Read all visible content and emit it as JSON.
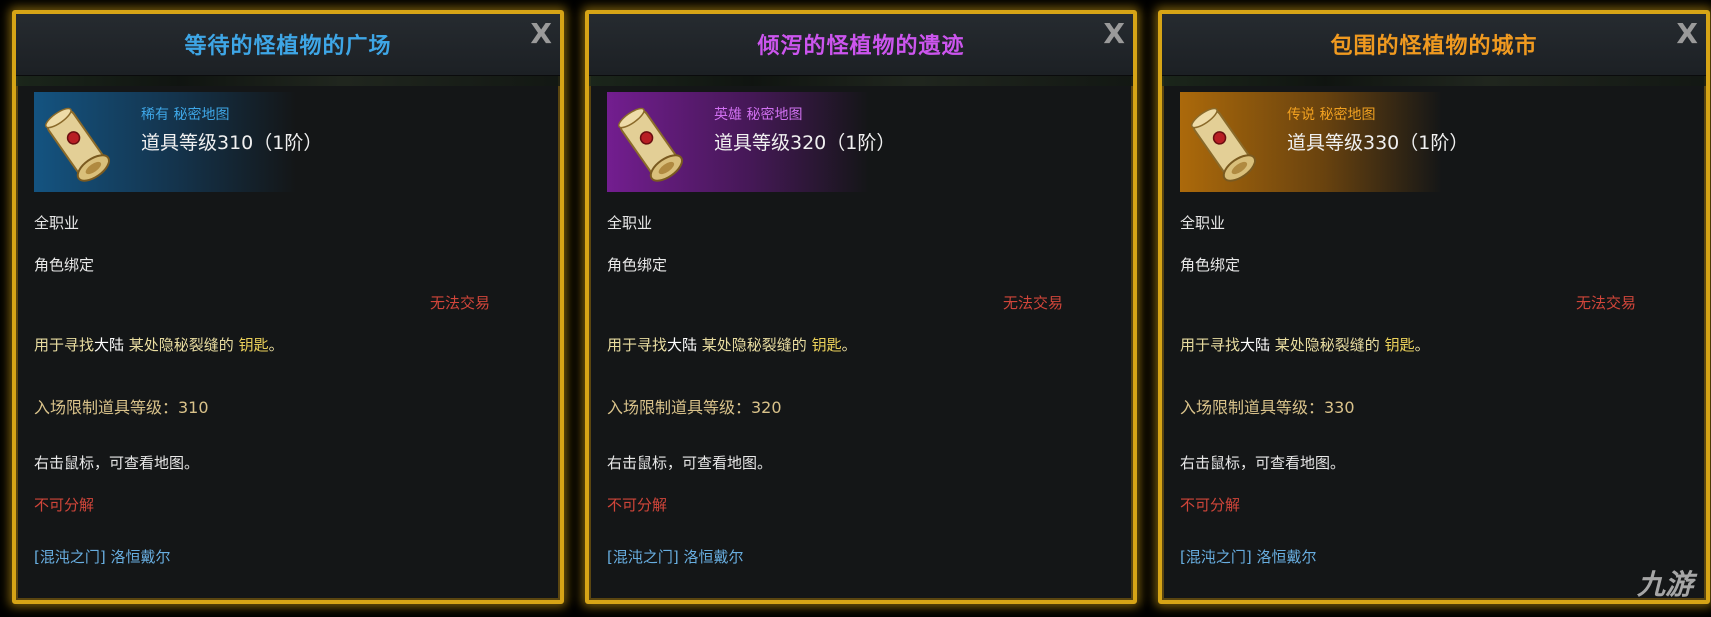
{
  "close_label": "X",
  "panels": [
    {
      "title": "等待的怪植物的广场",
      "title_color": "#3ea6e6",
      "rarity": "稀有 秘密地图",
      "rarity_color": "#3ea6e6",
      "item_level": "道具等级310（1阶）",
      "class": "全职业",
      "bind": "角色绑定",
      "trade": "无法交易",
      "use_prefix": "用于寻找",
      "use_mid": "大陆",
      "use_suffix": " 某处隐秘裂缝的 ",
      "use_key": "钥匙",
      "use_end": "。",
      "entry_level": "入场限制道具等级：310",
      "right_click": "右击鼠标，可查看地图。",
      "no_disassemble": "不可分解",
      "location": "[混沌之门] 洛恒戴尔"
    },
    {
      "title": "倾泻的怪植物的遗迹",
      "title_color": "#cc55ee",
      "rarity": "英雄 秘密地图",
      "rarity_color": "#d070f0",
      "item_level": "道具等级320（1阶）",
      "class": "全职业",
      "bind": "角色绑定",
      "trade": "无法交易",
      "use_prefix": "用于寻找",
      "use_mid": "大陆",
      "use_suffix": " 某处隐秘裂缝的 ",
      "use_key": "钥匙",
      "use_end": "。",
      "entry_level": "入场限制道具等级：320",
      "right_click": "右击鼠标，可查看地图。",
      "no_disassemble": "不可分解",
      "location": "[混沌之门] 洛恒戴尔"
    },
    {
      "title": "包围的怪植物的城市",
      "title_color": "#f09a20",
      "rarity": "传说 秘密地图",
      "rarity_color": "#f0a020",
      "item_level": "道具等级330（1阶）",
      "class": "全职业",
      "bind": "角色绑定",
      "trade": "无法交易",
      "use_prefix": "用于寻找",
      "use_mid": "大陆",
      "use_suffix": " 某处隐秘裂缝的 ",
      "use_key": "钥匙",
      "use_end": "。",
      "entry_level": "入场限制道具等级：330",
      "right_click": "右击鼠标，可查看地图。",
      "no_disassemble": "不可分解",
      "location": "[混沌之门] 洛恒戴尔"
    }
  ],
  "watermark": "九游",
  "icons": [
    "scroll-map-icon",
    "close-icon"
  ]
}
